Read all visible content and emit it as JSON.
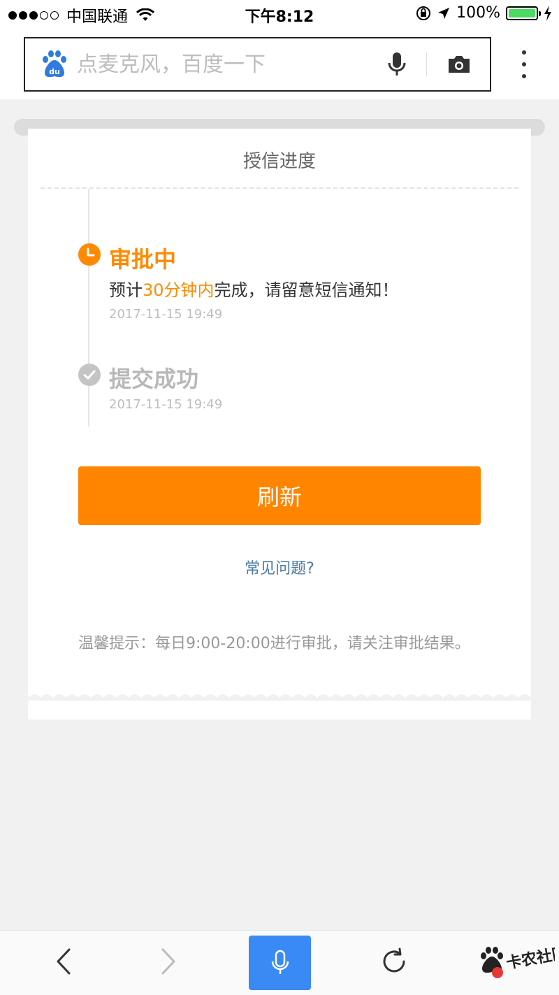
{
  "status_bar": {
    "carrier": "中国联通",
    "time": "下午8:12",
    "battery": "100%",
    "signal_icon": "signal-dots-icon",
    "wifi_icon": "wifi-icon",
    "orientation_lock_icon": "orientation-lock-icon",
    "location_icon": "location-arrow-icon",
    "charging_icon": "charging-bolt-icon"
  },
  "search": {
    "placeholder": "点麦克风，百度一下",
    "logo_icon": "baidu-paw-icon",
    "mic_icon": "microphone-icon",
    "camera_icon": "camera-icon",
    "menu_icon": "more-vertical-icon"
  },
  "card": {
    "title": "授信进度",
    "steps": [
      {
        "status": "审批中",
        "desc_prefix": "预计",
        "desc_highlight": "30分钟内",
        "desc_suffix": "完成，请留意短信通知！",
        "time": "2017-11-15 19:49",
        "icon": "clock-icon"
      },
      {
        "status": "提交成功",
        "time": "2017-11-15 19:49",
        "icon": "check-circle-icon"
      }
    ],
    "refresh_label": "刷新",
    "faq_label": "常见问题?",
    "tip": "温馨提示：每日9:00-20:00进行审批，请关注审批结果。"
  },
  "bottom_bar": {
    "back_icon": "chevron-left-icon",
    "forward_icon": "chevron-right-icon",
    "voice_icon": "microphone-icon",
    "reload_icon": "refresh-icon",
    "watermark": "卡农社区"
  },
  "colors": {
    "accent": "#ff8400",
    "link": "#4a7aa6",
    "voice_button": "#3a8af5",
    "battery": "#4cd964"
  }
}
